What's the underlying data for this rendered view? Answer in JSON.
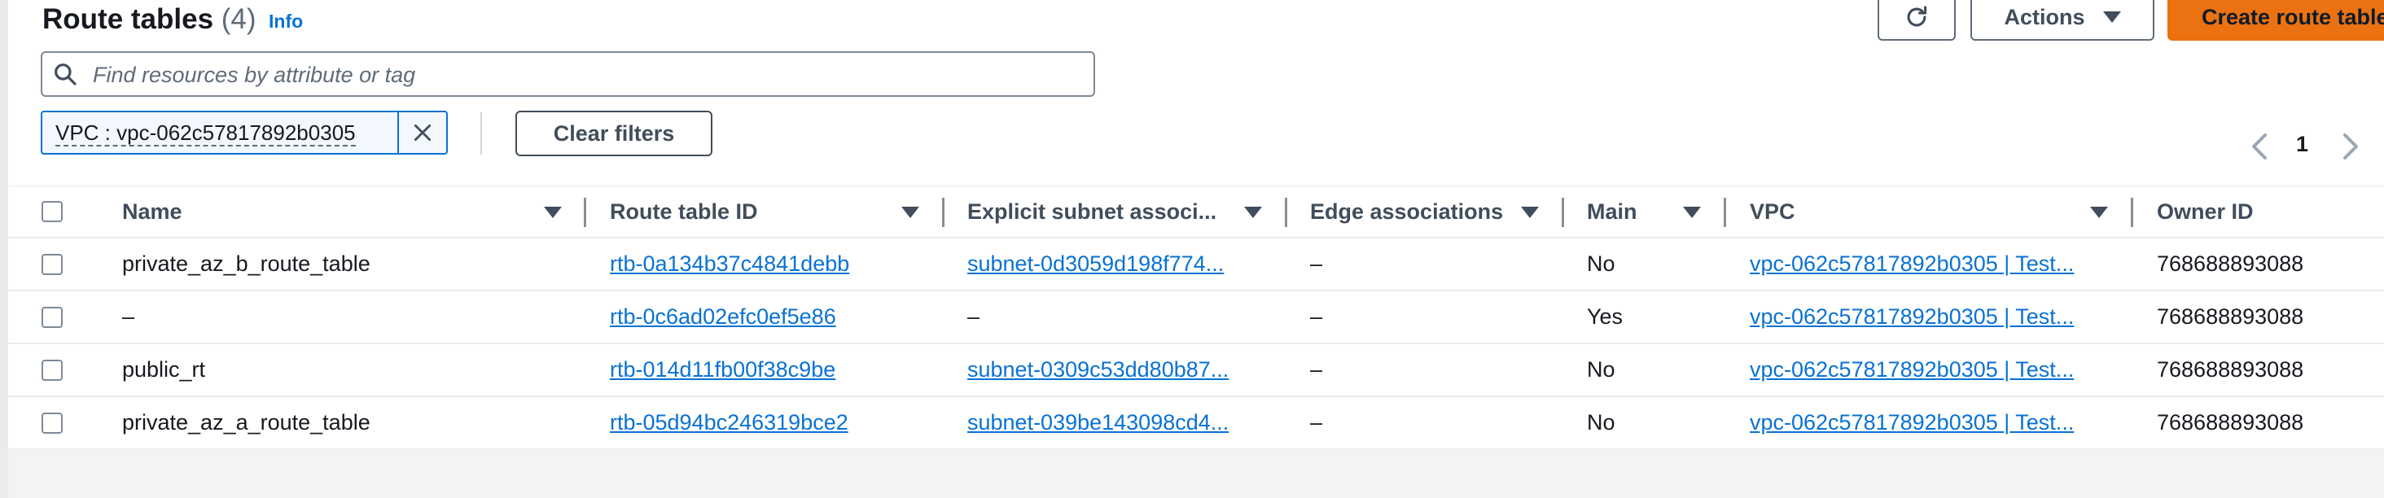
{
  "header": {
    "title": "Route tables",
    "count": "(4)",
    "info_label": "Info",
    "refresh_icon": "refresh-icon",
    "actions_label": "Actions",
    "create_label": "Create route table"
  },
  "search": {
    "placeholder": "Find resources by attribute or tag",
    "value": ""
  },
  "filter": {
    "token_label": "VPC : vpc-062c57817892b0305",
    "clear_label": "Clear filters"
  },
  "pagination": {
    "current_page": "1"
  },
  "table": {
    "columns": [
      "Name",
      "Route table ID",
      "Explicit subnet associ...",
      "Edge associations",
      "Main",
      "VPC",
      "Owner ID"
    ],
    "rows": [
      {
        "name": "private_az_b_route_table",
        "route_table_id": "rtb-0a134b37c4841debb",
        "subnet": "subnet-0d3059d198f774...",
        "edge": "–",
        "main": "No",
        "vpc": "vpc-062c57817892b0305 | Test...",
        "owner": "768688893088"
      },
      {
        "name": "–",
        "route_table_id": "rtb-0c6ad02efc0ef5e86",
        "subnet": "–",
        "edge": "–",
        "main": "Yes",
        "vpc": "vpc-062c57817892b0305 | Test...",
        "owner": "768688893088"
      },
      {
        "name": "public_rt",
        "route_table_id": "rtb-014d11fb00f38c9be",
        "subnet": "subnet-0309c53dd80b87...",
        "edge": "–",
        "main": "No",
        "vpc": "vpc-062c57817892b0305 | Test...",
        "owner": "768688893088"
      },
      {
        "name": "private_az_a_route_table",
        "route_table_id": "rtb-05d94bc246319bce2",
        "subnet": "subnet-039be143098cd4...",
        "edge": "–",
        "main": "No",
        "vpc": "vpc-062c57817892b0305 | Test...",
        "owner": "768688893088"
      }
    ]
  },
  "colors": {
    "link": "#0972d3",
    "primary_button": "#ec7211",
    "text": "#16191f",
    "muted_text": "#5f6b7a"
  }
}
